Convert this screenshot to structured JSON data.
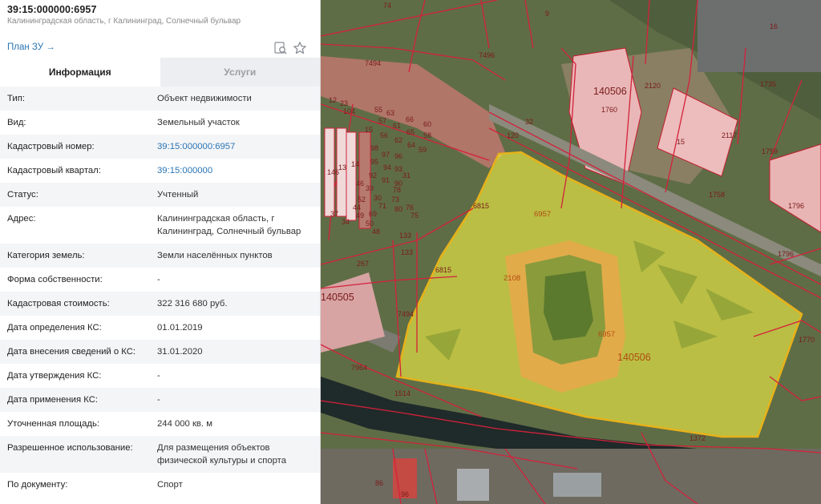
{
  "header": {
    "title": "39:15:000000:6957",
    "address_sub": "Калининградская область, г Калининград, Солнечный бульвар",
    "plan_link": "План ЗУ →"
  },
  "tabs": [
    {
      "label": "Информация",
      "active": true
    },
    {
      "label": "Услуги",
      "active": false
    }
  ],
  "rows": [
    {
      "label": "Тип:",
      "value": "Объект недвижимости",
      "link": false
    },
    {
      "label": "Вид:",
      "value": "Земельный участок",
      "link": false
    },
    {
      "label": "Кадастровый номер:",
      "value": "39:15:000000:6957",
      "link": true
    },
    {
      "label": "Кадастровый квартал:",
      "value": "39:15:000000",
      "link": true
    },
    {
      "label": "Статус:",
      "value": "Учтенный",
      "link": false
    },
    {
      "label": "Адрес:",
      "value": "Калининградская область, г Калининград, Солнечный бульвар",
      "link": false
    },
    {
      "label": "Категория земель:",
      "value": "Земли населённых пунктов",
      "link": false
    },
    {
      "label": "Форма собственности:",
      "value": "-",
      "link": false
    },
    {
      "label": "Кадастровая стоимость:",
      "value": "322 316 680 руб.",
      "link": false
    },
    {
      "label": "Дата определения КС:",
      "value": "01.01.2019",
      "link": false
    },
    {
      "label": "Дата внесения сведений о КС:",
      "value": "31.01.2020",
      "link": false
    },
    {
      "label": "Дата утверждения КС:",
      "value": "-",
      "link": false
    },
    {
      "label": "Дата применения КС:",
      "value": "-",
      "link": false
    },
    {
      "label": "Уточненная площадь:",
      "value": "244 000 кв. м",
      "link": false
    },
    {
      "label": "Разрешенное использование:",
      "value": "Для размещения объектов физической культуры и спорта",
      "link": false
    },
    {
      "label": "По документу:",
      "value": "Спорт",
      "link": false
    }
  ],
  "icons": {
    "search": "search-map-icon",
    "favorite": "star-icon"
  },
  "colors": {
    "link": "#2a74b4",
    "parcel_border": "#d4213a",
    "highlight_fill": "#f2f044",
    "highlight_border": "#e7b21a"
  },
  "map": {
    "labels": [
      "74",
      "9",
      "16",
      "7494",
      "7496",
      "140506",
      "2120",
      "1760",
      "1735",
      "32",
      "120",
      "15",
      "2117",
      "1759",
      "1758",
      "1796",
      "1796",
      "6957",
      "6957",
      "140506",
      "6815",
      "6815",
      "2108",
      "133",
      "133",
      "267",
      "140505",
      "7494",
      "1770",
      "7964",
      "1514",
      "1372",
      "55",
      "63",
      "66",
      "60",
      "57",
      "61",
      "65",
      "58",
      "56",
      "62",
      "64",
      "59",
      "31",
      "76",
      "75",
      "30",
      "23",
      "12",
      "104",
      "15",
      "146",
      "14",
      "13",
      "98",
      "97",
      "96",
      "95",
      "94",
      "93",
      "92",
      "91",
      "90",
      "34",
      "39",
      "37",
      "69",
      "71",
      "73",
      "78",
      "80",
      "52",
      "50",
      "48",
      "46",
      "44",
      "49",
      "86",
      "96"
    ]
  }
}
